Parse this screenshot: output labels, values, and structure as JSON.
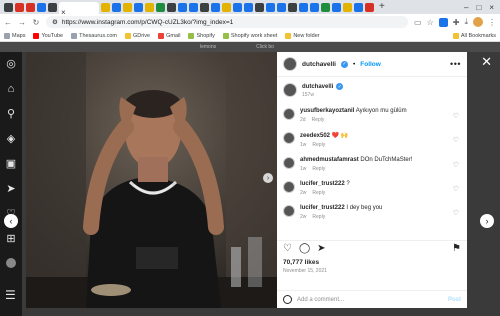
{
  "browser": {
    "url": "https://www.instagram.com/p/CWQ-cUZL3ko/?img_index=1",
    "tab_close": "×",
    "new_tab": "+",
    "window_controls": [
      "–",
      "□",
      "×"
    ]
  },
  "bookmarks": [
    "Maps",
    "YouTube",
    "Thesaurus.com",
    "GDrive",
    "Gmail",
    "Shopify",
    "Shopify work sheet",
    "New folder"
  ],
  "bookmarks_all": "All Bookmarks",
  "page_strip": [
    "lemons",
    "Click bo"
  ],
  "post": {
    "username": "dutchavelli",
    "follow_label": "Follow",
    "more": "•••",
    "caption_time": "157w",
    "likes": "70,777 likes",
    "date": "November 15, 2021",
    "add_comment_placeholder": "Add a comment...",
    "post_label": "Post"
  },
  "comments": [
    {
      "user": "yusufberkayoztanil",
      "text": "Ayıkıyon mu gülüm",
      "time": "2d",
      "reply": "Reply",
      "heart": "♡"
    },
    {
      "user": "zeedex502",
      "text": "❤️ 🙌",
      "time": "1w",
      "reply": "Reply",
      "heart": "♡"
    },
    {
      "user": "ahmedmustafamrast",
      "text": "DOn DuTchMaSter!",
      "time": "1w",
      "reply": "Reply",
      "heart": "♡"
    },
    {
      "user": "lucifer_trust222",
      "text": "?",
      "time": "2w",
      "reply": "Reply",
      "heart": "♡"
    },
    {
      "user": "lucifer_trust222",
      "text": "I dey beg you",
      "time": "2w",
      "reply": "Reply",
      "heart": "♡"
    }
  ],
  "colors": {
    "accent": "#0095f6",
    "verified": "#3897f0"
  }
}
